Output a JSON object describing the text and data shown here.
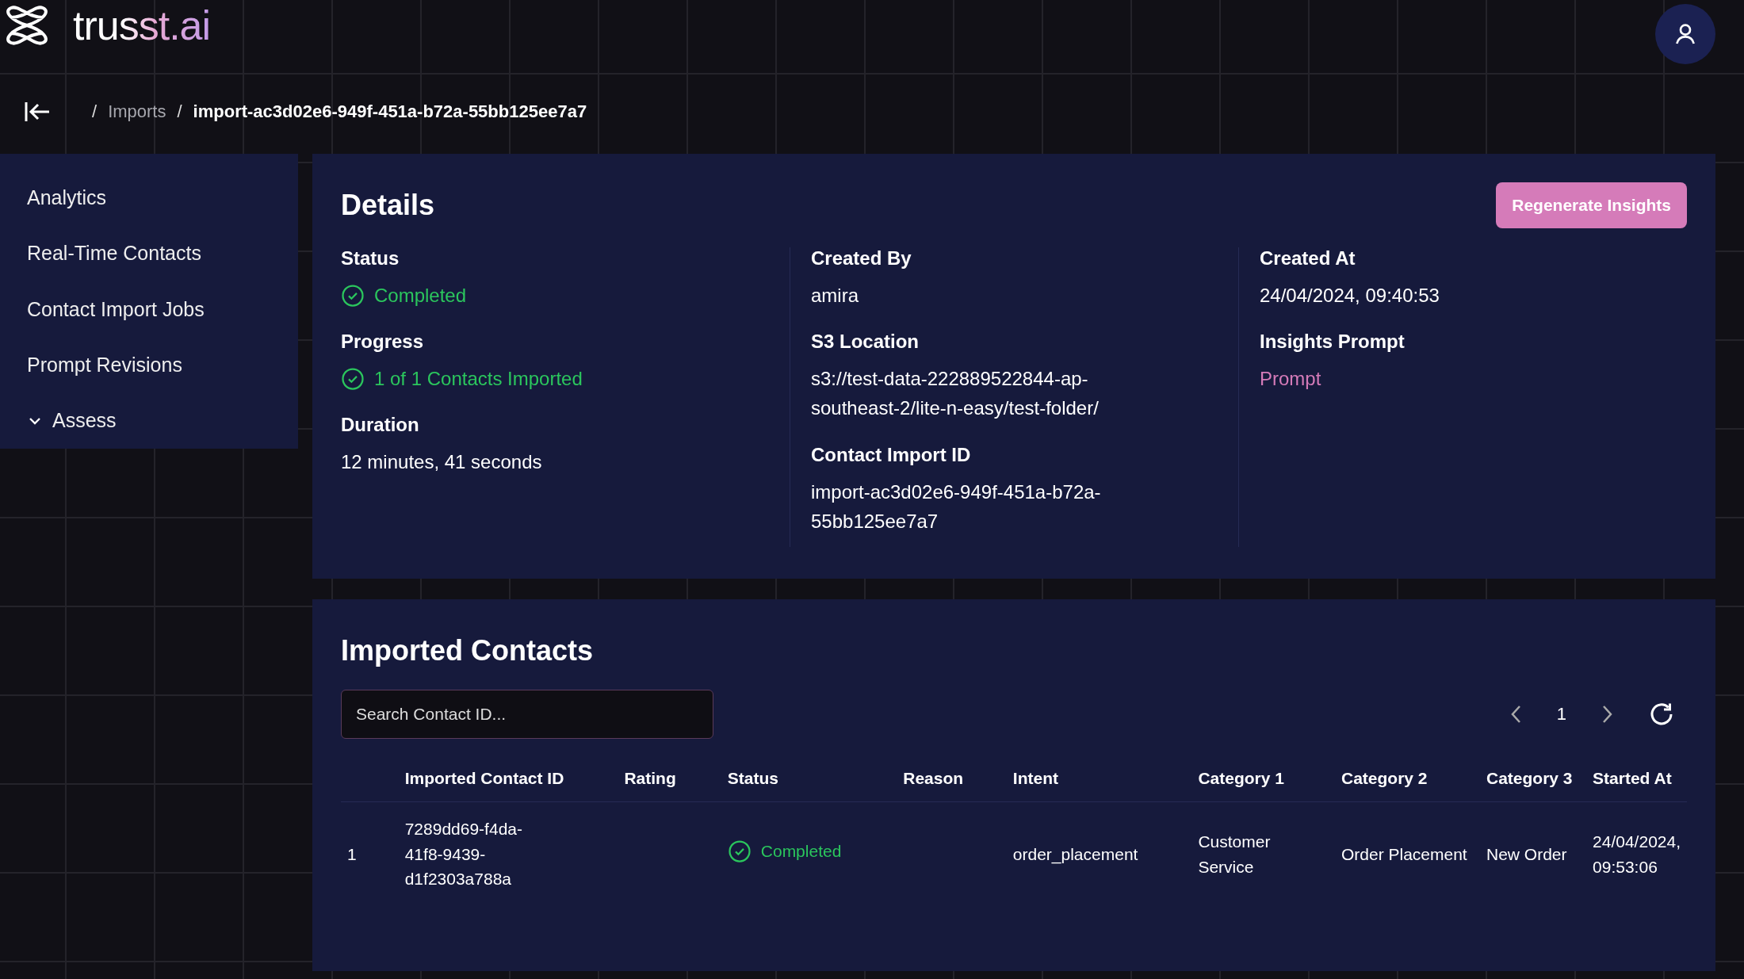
{
  "header": {
    "logo": "trusst.ai"
  },
  "breadcrumb": {
    "items": [
      {
        "separator": "/",
        "label": "Imports",
        "current": false
      },
      {
        "separator": "/",
        "label": "import-ac3d02e6-949f-451a-b72a-55bb125ee7a7",
        "current": true
      }
    ]
  },
  "sidebar": {
    "items": [
      {
        "label": "Analytics"
      },
      {
        "label": "Real-Time Contacts"
      },
      {
        "label": "Contact Import Jobs"
      },
      {
        "label": "Prompt Revisions"
      },
      {
        "label": "Assess",
        "expanded": true
      }
    ]
  },
  "details": {
    "title": "Details",
    "action": "Regenerate Insights",
    "columns": [
      [
        {
          "label": "Status",
          "value": "Completed",
          "kind": "status"
        },
        {
          "label": "Progress",
          "value": "1 of 1 Contacts Imported",
          "kind": "status"
        },
        {
          "label": "Duration",
          "value": "12 minutes, 41 seconds",
          "kind": "text"
        }
      ],
      [
        {
          "label": "Created By",
          "value": "amira",
          "kind": "text"
        },
        {
          "label": "S3 Location",
          "value": "s3://test-data-222889522844-ap-southeast-2/lite-n-easy/test-folder/",
          "kind": "text"
        },
        {
          "label": "Contact Import ID",
          "value": "import-ac3d02e6-949f-451a-b72a-55bb125ee7a7",
          "kind": "text"
        }
      ],
      [
        {
          "label": "Created At",
          "value": "24/04/2024, 09:40:53",
          "kind": "text"
        },
        {
          "label": "Insights Prompt",
          "value": "Prompt",
          "kind": "link"
        }
      ]
    ]
  },
  "contacts": {
    "title": "Imported Contacts",
    "search": {
      "placeholder": "Search Contact ID..."
    },
    "pagination": {
      "page": "1"
    },
    "columns": [
      "",
      "Imported Contact ID",
      "Rating",
      "Status",
      "Reason",
      "Intent",
      "Category 1",
      "Category 2",
      "Category 3",
      "Started At"
    ],
    "rows": [
      {
        "index": "1",
        "contact_id": "7289dd69-f4da-41f8-9439-d1f2303a788a",
        "status": "Completed",
        "intent": "order_placement",
        "category_1": "Customer Service",
        "category_2": "Order Placement",
        "category_3": "New Order",
        "started_at": "24/04/2024, 09:53:06"
      }
    ]
  }
}
